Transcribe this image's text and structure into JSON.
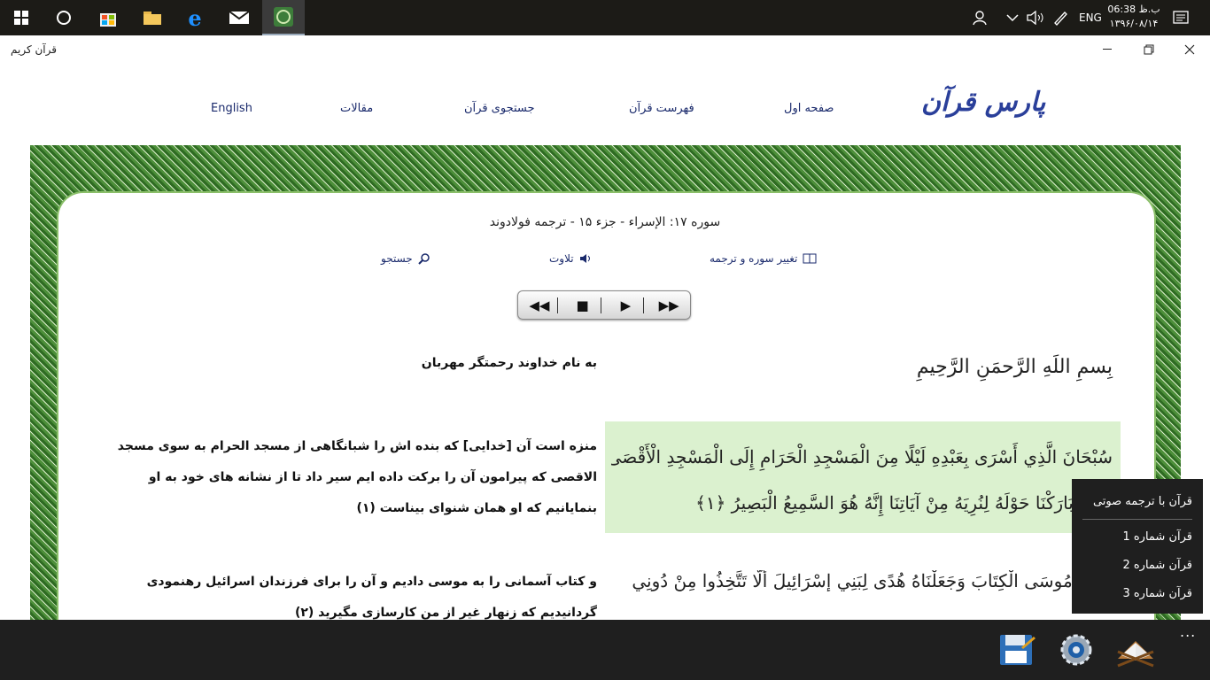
{
  "taskbar": {
    "clock_time": "06:38 ب.ظ",
    "clock_date": "۱۳۹۶/۰۸/۱۴",
    "language": "ENG"
  },
  "window": {
    "title": "قرآن کریم"
  },
  "nav": {
    "logo": "پارس قرآن",
    "home": "صفحه اول",
    "index": "فهرست قرآن",
    "search": "جستجوی قرآن",
    "articles": "مقالات",
    "english": "English"
  },
  "surah": {
    "title": "سوره ۱۷: الإسراء - جزء ۱۵ - ترجمه فولادوند"
  },
  "tools": {
    "change": "تغییر سوره و ترجمه",
    "recite": "تلاوت",
    "search": "جستجو"
  },
  "player": {
    "prev": "◀◀",
    "stop": "■",
    "play": "▶",
    "next": "▶▶"
  },
  "verses": {
    "bismillah_ar": "بِسمِ اللَهِ الرَّحمَنِ الرَّحِيمِ",
    "bismillah_fa": "به نام خداوند رحمتگر مهربان",
    "v1_ar_line1": "سُبْحَانَ الَّذِي أَسْرَى بِعَبْدِهِ لَيْلًا مِنَ الْمَسْجِدِ الْحَرَامِ إِلَى الْمَسْجِدِ الْأَقْصَى",
    "v1_ar_line2": "الَّذِي بَارَكْنَا حَوْلَهُ لِنُرِيَهُ مِنْ آيَاتِنَا إِنَّهُ هُوَ السَّمِيعُ الْبَصِيرُ ﴿١﴾",
    "v1_fa": "منزه است آن [خدایی] که بنده اش را شبانگاهی از مسجد الحرام به سوی مسجد الاقصی که پیرامون آن را برکت داده ایم سیر داد تا از نشانه های خود به او بنمایانیم که او همان شنوای بیناست (۱)",
    "v2_ar_line1": "وَآتَيْنَا مُوسَى الْكِتَابَ وَجَعَلْنَاهُ هُدًى لِبَنِي إِسْرَائِيلَ أَلَّا تَتَّخِذُوا مِنْ دُونِي",
    "v2_fa": "و کتاب آسمانی را به موسی دادیم و آن را برای فرزندان اسرائیل رهنمودی گردانیدیم که زنهار غیر از من کارسازی مگیرید (۲)"
  },
  "menu": {
    "header": "قرآن با ترجمه صوتی",
    "items": [
      "قرآن شماره 1",
      "قرآن شماره 2",
      "قرآن شماره 3"
    ]
  },
  "appbar": {
    "more": "..."
  }
}
